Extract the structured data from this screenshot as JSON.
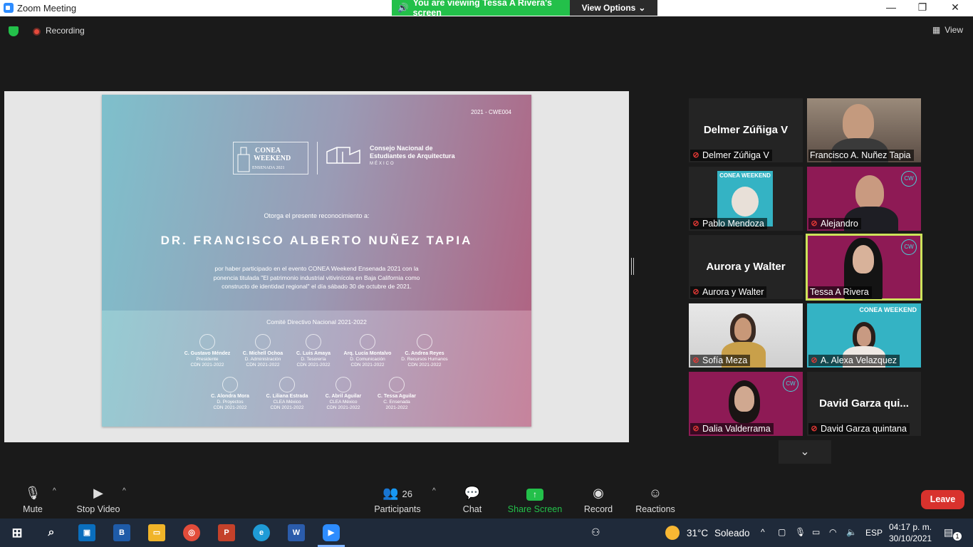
{
  "window": {
    "title": "Zoom Meeting",
    "banner": "You are viewing Tessa A Rivera's screen",
    "view_options": "View Options",
    "minimize": "—",
    "restore": "❐",
    "close": "✕"
  },
  "topbar": {
    "recording": "Recording",
    "view": "View"
  },
  "certificate": {
    "code": "2021 - CWE004",
    "logo_line1": "CONEA",
    "logo_line2": "WEEKEND",
    "logo_line3": "ENSENADA 2021",
    "org_line1": "Consejo Nacional de",
    "org_line2": "Estudiantes de Arquitectura",
    "org_line3": "MÉXICO",
    "otorga": "Otorga el presente reconocimiento a:",
    "recipient": "DR. FRANCISCO ALBERTO NUÑEZ TAPIA",
    "paragraph": "por haber participado en el evento CONEA Weekend Ensenada 2021 con la ponencia titulada \"El patrimonio industrial vitivinícola en Baja California como constructo de identidad regional\" el día sábado 30 de octubre de 2021.",
    "comite": "Comité Directivo Nacional 2021-2022",
    "signers_row1": [
      {
        "name": "C. Gustavo Méndez",
        "role": "Presidente",
        "period": "CDN 2021-2022"
      },
      {
        "name": "C. Michell Ochoa",
        "role": "D. Administración",
        "period": "CDN 2021-2022"
      },
      {
        "name": "C. Luis Amaya",
        "role": "D. Tesorería",
        "period": "CDN 2021-2022"
      },
      {
        "name": "Arq. Lucía Montalvo",
        "role": "D. Comunicación",
        "period": "CDN 2021-2022"
      },
      {
        "name": "C. Andrea Reyes",
        "role": "D. Recursos Humanos",
        "period": "CDN 2021-2022"
      }
    ],
    "signers_row2": [
      {
        "name": "C. Alondra Mora",
        "role": "D. Proyectos",
        "period": "CDN 2021-2022"
      },
      {
        "name": "C. Liliana Estrada",
        "role": "CLEA México",
        "period": "CDN 2021-2022"
      },
      {
        "name": "C. Abril Aguilar",
        "role": "CLEA México",
        "period": "CDN 2021-2022"
      },
      {
        "name": "C. Tessa Aguilar",
        "role": "C. Ensenada",
        "period": "2021-2022"
      }
    ]
  },
  "gallery": {
    "tiles": [
      {
        "label": "Delmer Zúñiga V",
        "big_name": "Delmer Zúñiga V",
        "muted": true
      },
      {
        "label": "Francisco A. Nuñez Tapia",
        "muted": false
      },
      {
        "label": "Pablo Mendoza",
        "muted": true,
        "overlay": "CONEA WEEKEND"
      },
      {
        "label": "Alejandro",
        "muted": true,
        "badge": "CW"
      },
      {
        "label": "Aurora y Walter",
        "big_name": "Aurora y Walter",
        "muted": true
      },
      {
        "label": "Tessa A Rivera",
        "muted": false,
        "badge": "CW"
      },
      {
        "label": "Sofía Meza",
        "muted": true
      },
      {
        "label": "A. Alexa Velazquez",
        "muted": true,
        "overlay": "CONEA WEEKEND"
      },
      {
        "label": "Dalia Valderrama",
        "muted": true,
        "badge": "CW"
      },
      {
        "label": "David Garza quintana",
        "big_name": "David Garza qui...",
        "muted": true
      }
    ],
    "collapse_icon": "chevron-down-icon"
  },
  "toolbar": {
    "mute": "Mute",
    "stop_video": "Stop Video",
    "participants": "Participants",
    "participants_count": "26",
    "chat": "Chat",
    "share_screen": "Share Screen",
    "record": "Record",
    "reactions": "Reactions",
    "leave": "Leave"
  },
  "taskbar": {
    "weather_temp": "31°C",
    "weather_desc": "Soleado",
    "language": "ESP",
    "time": "04:17 p. m.",
    "date": "30/10/2021",
    "notifications": "1"
  },
  "colors": {
    "zoom_green": "#23c04a",
    "leave_red": "#d8322d",
    "active_speaker": "#cde35a"
  }
}
